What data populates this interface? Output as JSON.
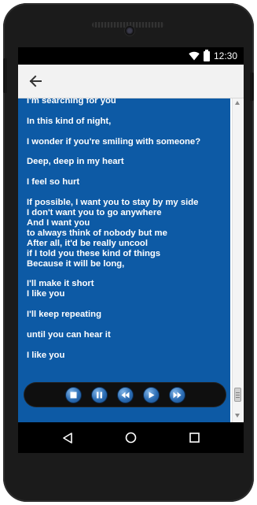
{
  "status_bar": {
    "time": "12:30",
    "icons": [
      "wifi-icon",
      "battery-icon"
    ]
  },
  "app_bar": {
    "back_icon": "arrow-left-icon"
  },
  "colors": {
    "lyrics_background": "#0d5aa5",
    "player_bar": "#0f0f0f",
    "control_button": "#2b6cb3"
  },
  "lyrics": {
    "text": "I'm searching for you\n\nIn this kind of night,\n\nI wonder if you're smiling with someone?\n\nDeep, deep in my heart\n\nI feel so hurt\n\nIf possible, I want you to stay by my side\nI don't want you to go anywhere\nAnd I want you\nto always think of nobody but me\nAfter all, it'd be really uncool\nif I told you these kind of things\nBecause it will be long,\n\nI'll make it short\nI like you\n\nI'll keep repeating\n\nuntil you can hear it\n\nI like you"
  },
  "player": {
    "controls": [
      "stop-icon",
      "pause-icon",
      "rewind-icon",
      "play-icon",
      "fast-forward-icon"
    ]
  },
  "nav_bar": {
    "buttons": [
      "back-triangle-icon",
      "home-circle-icon",
      "recents-square-icon"
    ]
  }
}
